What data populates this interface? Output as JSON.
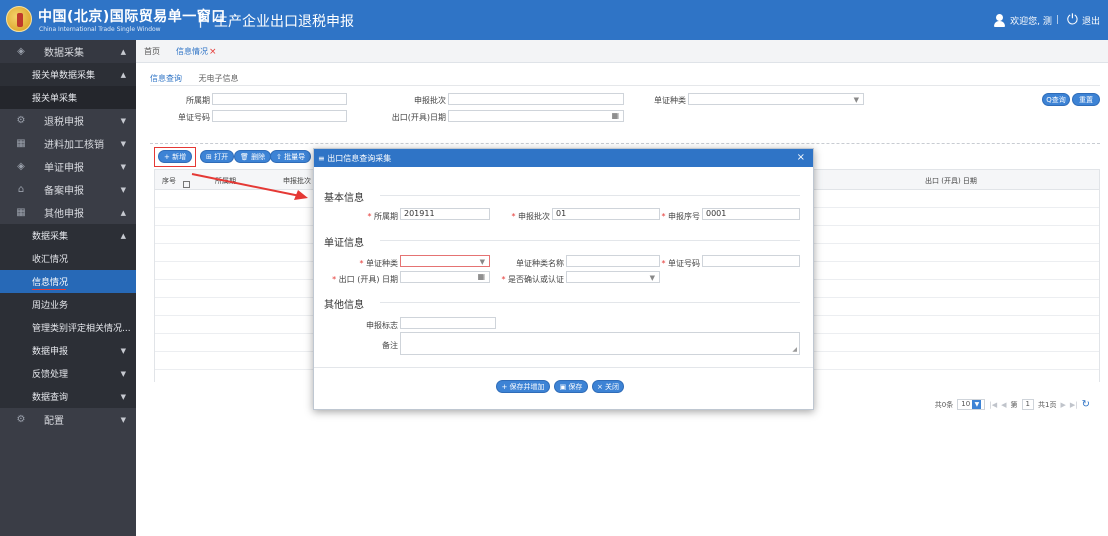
{
  "header": {
    "logo_cn": "中国(北京)国际贸易单一窗口",
    "logo_en": "China International Trade Single Window",
    "separator": "|",
    "page_title": "生产企业出口退税申报",
    "welcome": "欢迎您, 测",
    "logout": "退出",
    "color": "#2f74c6"
  },
  "sidebar": {
    "items": [
      {
        "label": "数据采集",
        "icon": "layers-icon"
      },
      {
        "label": "报关单数据采集"
      },
      {
        "label": "报关单采集"
      },
      {
        "label": "退税申报",
        "icon": "gear-icon"
      },
      {
        "label": "进料加工核销",
        "icon": "grid-icon"
      },
      {
        "label": "单证申报",
        "icon": "layers-icon"
      },
      {
        "label": "备案申报",
        "icon": "building-icon"
      },
      {
        "label": "其他申报",
        "icon": "grid-icon"
      },
      {
        "label": "数据采集"
      },
      {
        "label": "收汇情况"
      },
      {
        "label": "信息情况"
      },
      {
        "label": "周边业务"
      },
      {
        "label": "管理类别评定相关情况..."
      },
      {
        "label": "数据申报"
      },
      {
        "label": "反馈处理"
      },
      {
        "label": "数据查询"
      },
      {
        "label": "配置",
        "icon": "gear-icon"
      }
    ]
  },
  "tabs": {
    "home": "首页",
    "active": "信息情况",
    "close": "×"
  },
  "subtabs": [
    "信息查询",
    "无电子信息"
  ],
  "filters": {
    "period_label": "所属期",
    "batch_label": "申报批次",
    "doc_type_label": "单证种类",
    "doc_no_label": "单证号码",
    "date_label": "出口(开具)日期",
    "query_btn": "Q查询",
    "reset_btn": "重置"
  },
  "toolbar": {
    "add": "+ 新增",
    "open": "打开",
    "delete": "删除",
    "batch": "批量导"
  },
  "grid": {
    "col_seq": "序号",
    "col_period": "所属期",
    "col_batch": "申报批次",
    "col_date": "出口 (开具) 日期"
  },
  "pager": {
    "total": "共0条",
    "page_size": "10",
    "page_prefix": "第",
    "page": "1",
    "pages": "共1页"
  },
  "modal": {
    "title": "出口信息查询采集",
    "close": "×",
    "section_basic": "基本信息",
    "period_label": "所属期",
    "period_value": "201911",
    "batch_label": "申报批次",
    "batch_value": "01",
    "seq_label": "申报序号",
    "seq_value": "0001",
    "section_doc": "单证信息",
    "doc_type_label": "单证种类",
    "doc_type_name_label": "单证种类名称",
    "doc_no_label": "单证号码",
    "date_label": "出口 (开具) 日期",
    "confirm_label": "是否确认或认证",
    "section_other": "其他信息",
    "flag_label": "申报标志",
    "remark_label": "备注",
    "btn_save_add": "保存并增加",
    "btn_save": "保存",
    "btn_close": "关闭"
  }
}
